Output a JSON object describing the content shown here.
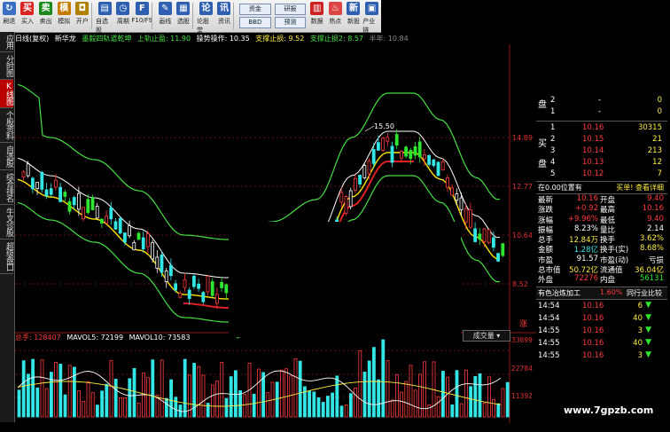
{
  "toolbar": {
    "buttons": [
      {
        "label": "刷退",
        "icon": "refresh-icon",
        "color": "#3a6fc4",
        "glyph": "↻"
      },
      {
        "label": "买入",
        "icon": "buy-icon",
        "color": "#d22",
        "glyph": "买"
      },
      {
        "label": "卖出",
        "icon": "sell-icon",
        "color": "#1a8a1a",
        "glyph": "卖"
      },
      {
        "label": "模拟",
        "icon": "simulate-icon",
        "color": "#c77b00",
        "glyph": "模"
      },
      {
        "label": "开户",
        "icon": "lock-icon",
        "color": "#b08000",
        "glyph": "◘"
      },
      {
        "label": "自选股",
        "icon": "watchlist-icon",
        "color": "#2e5fb0",
        "glyph": "▤"
      },
      {
        "label": "周期",
        "icon": "period-icon",
        "color": "#2e5fb0",
        "glyph": "◷"
      },
      {
        "label": "F10/F9",
        "icon": "f10-icon",
        "color": "#2e5fb0",
        "glyph": "F"
      },
      {
        "label": "画线",
        "icon": "draw-line-icon",
        "color": "#2e5fb0",
        "glyph": "✎"
      },
      {
        "label": "选股",
        "icon": "pick-stock-icon",
        "color": "#2e5fb0",
        "glyph": "▦"
      },
      {
        "label": "论股堂",
        "icon": "forum-icon",
        "color": "#2e5fb0",
        "glyph": "论"
      },
      {
        "label": "资讯",
        "icon": "news-icon",
        "color": "#2e5fb0",
        "glyph": "讯"
      }
    ],
    "double1": [
      "资金",
      "BBD"
    ],
    "double2": [
      "研报",
      "预测"
    ],
    "buttons2": [
      {
        "label": "数据",
        "icon": "data-icon",
        "color": "#c22",
        "glyph": "▥"
      },
      {
        "label": "热点",
        "icon": "hot-icon",
        "color": "#d44",
        "glyph": "♨"
      },
      {
        "label": "新股",
        "icon": "new-stock-icon",
        "color": "#2e5fb0",
        "glyph": "新"
      },
      {
        "label": "产业链",
        "icon": "industry-chain-icon",
        "color": "#2e5fb0",
        "glyph": "▣"
      }
    ]
  },
  "left_tabs": [
    {
      "label": "应用",
      "active": false
    },
    {
      "label": "分时图",
      "active": false
    },
    {
      "label": "K线图",
      "active": true
    },
    {
      "label": "个股资料",
      "active": false
    },
    {
      "label": "自选股",
      "active": false
    },
    {
      "label": "综合排名",
      "active": false
    },
    {
      "label": "牛叉诊股",
      "active": false
    },
    {
      "label": "超级盘口",
      "active": false
    }
  ],
  "header": {
    "t1": "日线(复权)",
    "t2": "新华龙",
    "t3": "墨毅四轨道乾坤",
    "t4": "上轨止盈: 11.90",
    "t5": "操势操作: 10.35",
    "t6": "支撑止损: 9.52",
    "t7": "支撑止损2: 8.57",
    "t8": "半年: 10.84"
  },
  "price_axis": [
    "14.89",
    "12.77",
    "10.64",
    "8.52"
  ],
  "peak_label": "15.50",
  "volume_header": {
    "total": "总手: 128407",
    "mav5": "MAVOL5: 72199",
    "mav10": "MAVOL10: 73583"
  },
  "volume_axis": [
    "33899",
    "22784",
    "11392"
  ],
  "volume_selector": "成交量",
  "corner_label": "涨",
  "watermark": "www.7gpzb.com",
  "order_book": {
    "sell_label": "卖",
    "sell_label2": "盘",
    "buy_label": "买",
    "buy_label2": "盘",
    "sell": [
      {
        "lv": "2",
        "price": "-",
        "vol": "0"
      },
      {
        "lv": "1",
        "price": "-",
        "vol": "0"
      }
    ],
    "buy": [
      {
        "lv": "1",
        "price": "10.16",
        "vol": "30315"
      },
      {
        "lv": "2",
        "price": "10.15",
        "vol": "21"
      },
      {
        "lv": "3",
        "price": "10.14",
        "vol": "213"
      },
      {
        "lv": "4",
        "price": "10.13",
        "vol": "12"
      },
      {
        "lv": "5",
        "price": "10.12",
        "vol": "7"
      }
    ]
  },
  "position_bar": {
    "left": "在0.00位置有",
    "right": "买单! 查看详细"
  },
  "quote": [
    {
      "k1": "最新",
      "v1": "10.16",
      "k2": "开盘",
      "v2": "9.40",
      "c1": "red",
      "c2": "red"
    },
    {
      "k1": "涨跌",
      "v1": "+0.92",
      "k2": "最高",
      "v2": "10.16",
      "c1": "red",
      "c2": "red"
    },
    {
      "k1": "涨幅",
      "v1": "+9.96%",
      "k2": "最低",
      "v2": "9.40",
      "c1": "red",
      "c2": "red"
    },
    {
      "k1": "振幅",
      "v1": "8.23%",
      "k2": "量比",
      "v2": "2.14",
      "c1": "white",
      "c2": "white"
    },
    {
      "k1": "总手",
      "v1": "12.84万",
      "k2": "换手",
      "v2": "3.62%",
      "c1": "yel",
      "c2": "yel"
    },
    {
      "k1": "金额",
      "v1": "1.28亿",
      "k2": "换手(实)",
      "v2": "8.68%",
      "c1": "cyan",
      "c2": "yel"
    },
    {
      "k1": "市盈",
      "v1": "91.57",
      "k2": "市盈(动)",
      "v2": "亏损",
      "c1": "white",
      "c2": "white"
    },
    {
      "k1": "总市值",
      "v1": "50.72亿",
      "k2": "流通值",
      "v2": "36.04亿",
      "c1": "yel",
      "c2": "yel"
    },
    {
      "k1": "外盘",
      "v1": "72276",
      "k2": "内盘",
      "v2": "56131",
      "c1": "red",
      "c2": "green"
    }
  ],
  "industry": {
    "name": "有色冶炼加工",
    "pct": "1.60%",
    "tab": "同行业比较"
  },
  "trades": [
    {
      "t": "14:54",
      "p": "10.16",
      "v": "6"
    },
    {
      "t": "14:54",
      "p": "10.16",
      "v": "40"
    },
    {
      "t": "14:55",
      "p": "10.16",
      "v": "3"
    },
    {
      "t": "14:55",
      "p": "10.16",
      "v": "40"
    },
    {
      "t": "14:55",
      "p": "10.16",
      "v": "3"
    }
  ],
  "colors": {
    "up": "#ff3b3b",
    "down": "#2ee62e",
    "cyan": "#33e6e6",
    "upper": "#46e046",
    "middle": "#ffffff",
    "lower": "#ffe100",
    "ma_red": "#e02020",
    "ma_blue": "#2238d6"
  }
}
